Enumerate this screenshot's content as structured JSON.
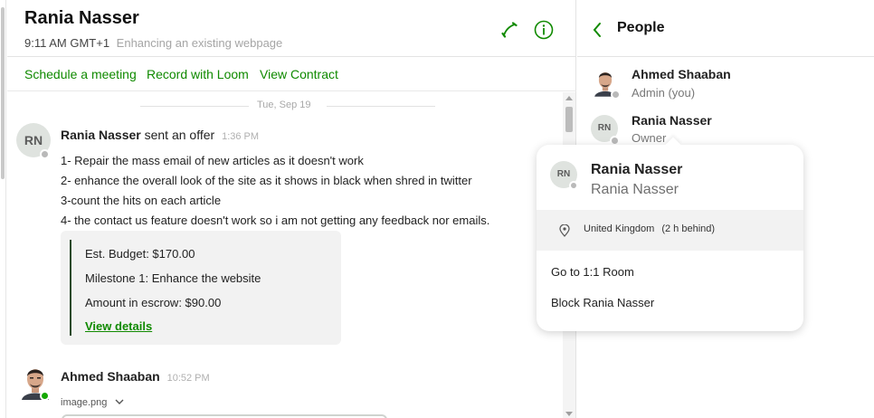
{
  "chat": {
    "header": {
      "title": "Rania Nasser",
      "local_time": "9:11 AM GMT+1",
      "project": "Enhancing an existing webpage",
      "phone_icon": "phone-icon",
      "info_icon": "info-icon"
    },
    "actions": [
      "Schedule a meeting",
      "Record with Loom",
      "View Contract"
    ],
    "date_separator": "Tue, Sep 19",
    "offer_message": {
      "avatar_initials": "RN",
      "sender": "Rania Nasser",
      "action": "sent an offer",
      "time": "1:36 PM",
      "lines": [
        "1- Repair the mass email of new articles as it doesn't work",
        "2- enhance the overall look of the site as it shows in black when shred in twitter",
        "3-count the hits on each article",
        "4- the contact us feature doesn't work so i am not getting any feedback nor emails."
      ],
      "card": {
        "budget": "Est. Budget: $170.00",
        "milestone": "Milestone 1: Enhance the website",
        "escrow": "Amount in escrow: $90.00",
        "link": "View details"
      }
    },
    "second_message": {
      "sender": "Ahmed Shaaban",
      "time": "10:52 PM",
      "attachment": "image.png"
    }
  },
  "people": {
    "title": "People",
    "members": [
      {
        "name": "Ahmed Shaaban",
        "role": "Admin (you)"
      },
      {
        "name": "Rania Nasser",
        "role": "Owner",
        "initials": "RN"
      }
    ]
  },
  "popover": {
    "initials": "RN",
    "name": "Rania Nasser",
    "subtitle": "Rania Nasser",
    "location": "United Kingdom",
    "time_offset": "(2 h behind)",
    "items": [
      "Go to 1:1 Room",
      "Block Rania Nasser"
    ]
  },
  "colors": {
    "accent": "#108a00",
    "online": "#14a800",
    "offline": "#b9b9b9",
    "avatar_bg": "#dfe3df"
  }
}
